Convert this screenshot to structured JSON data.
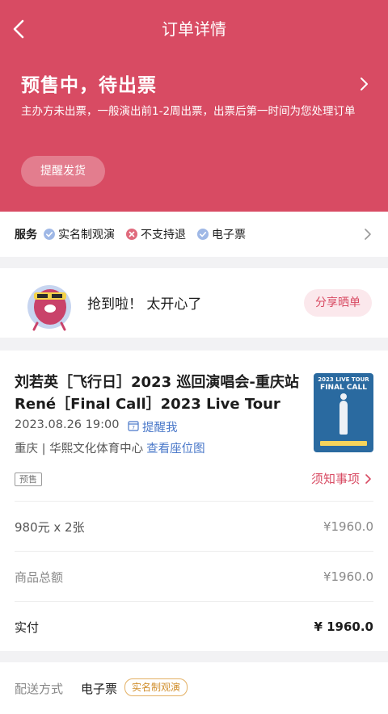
{
  "header": {
    "title": "订单详情",
    "status": "预售中，待出票",
    "description": "主办方未出票，一般演出前1-2周出票，出票后第一时间为您处理订单",
    "remind_button": "提醒发货",
    "bg_color": "#d84b63"
  },
  "services": {
    "title": "服务",
    "items": [
      {
        "label": "实名制观演",
        "icon": "check-icon"
      },
      {
        "label": "不支持退",
        "icon": "x-icon"
      },
      {
        "label": "电子票",
        "icon": "check-icon"
      }
    ]
  },
  "share": {
    "text": "抢到啦！  太开心了",
    "button": "分享晒单"
  },
  "show": {
    "title": "刘若英［飞行日］2023 巡回演唱会-重庆站René［Final Call］2023 Live Tour",
    "datetime": "2023.08.26 19:00",
    "remind_me": "提醒我",
    "venue": "重庆 | 华熙文化体育中心",
    "seat_link": "查看座位图",
    "badge": "预售",
    "notice": "须知事项",
    "poster": {
      "top_text": "2023 LIVE TOUR",
      "sub_text": "FINAL CALL"
    }
  },
  "price": {
    "rows": [
      {
        "label": "980元 x 2张",
        "value": "¥1960.0"
      },
      {
        "label": "商品总额",
        "value": "¥1960.0"
      },
      {
        "label": "实付",
        "value": "¥ 1960.0"
      }
    ]
  },
  "delivery": {
    "label": "配送方式",
    "value": "电子票",
    "badge": "实名制观演"
  }
}
